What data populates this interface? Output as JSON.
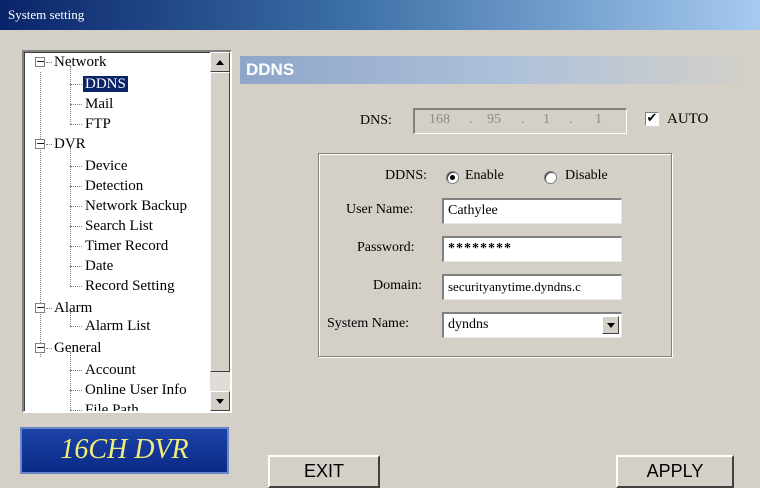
{
  "window": {
    "title": "System setting"
  },
  "tree": {
    "network": {
      "label": "Network",
      "expander": "−",
      "children": [
        "DDNS",
        "Mail",
        "FTP"
      ]
    },
    "dvr": {
      "label": "DVR",
      "expander": "−",
      "children": [
        "Device",
        "Detection",
        "Network Backup",
        "Search List",
        "Timer Record",
        "Date",
        "Record Setting"
      ]
    },
    "alarm": {
      "label": "Alarm",
      "expander": "−",
      "children": [
        "Alarm List"
      ]
    },
    "general": {
      "label": "General",
      "expander": "−",
      "children": [
        "Account",
        "Online User Info",
        "File Path"
      ]
    },
    "selected": "DDNS"
  },
  "logo": {
    "text": "16CH DVR"
  },
  "section": {
    "title": "DDNS"
  },
  "dns": {
    "label": "DNS:",
    "octets": [
      "168",
      "95",
      "1",
      "1"
    ],
    "auto_label": "AUTO",
    "auto_checked": true,
    "check_mark": "✔"
  },
  "form": {
    "ddns_label": "DDNS:",
    "enable_label": "Enable",
    "disable_label": "Disable",
    "selected": "Enable",
    "username_label": "User Name:",
    "username_value": "Cathylee",
    "password_label": "Password:",
    "password_value": "********",
    "domain_label": "Domain:",
    "domain_value": "securityanytime.dyndns.c",
    "systemname_label": "System Name:",
    "systemname_value": "dyndns"
  },
  "buttons": {
    "exit": "EXIT",
    "apply": "APPLY"
  },
  "colors": {
    "title_bar": "#0a246a",
    "selection": "#0a246a",
    "logo_bg": "#1c43a8",
    "logo_text": "#f2ee7a"
  }
}
